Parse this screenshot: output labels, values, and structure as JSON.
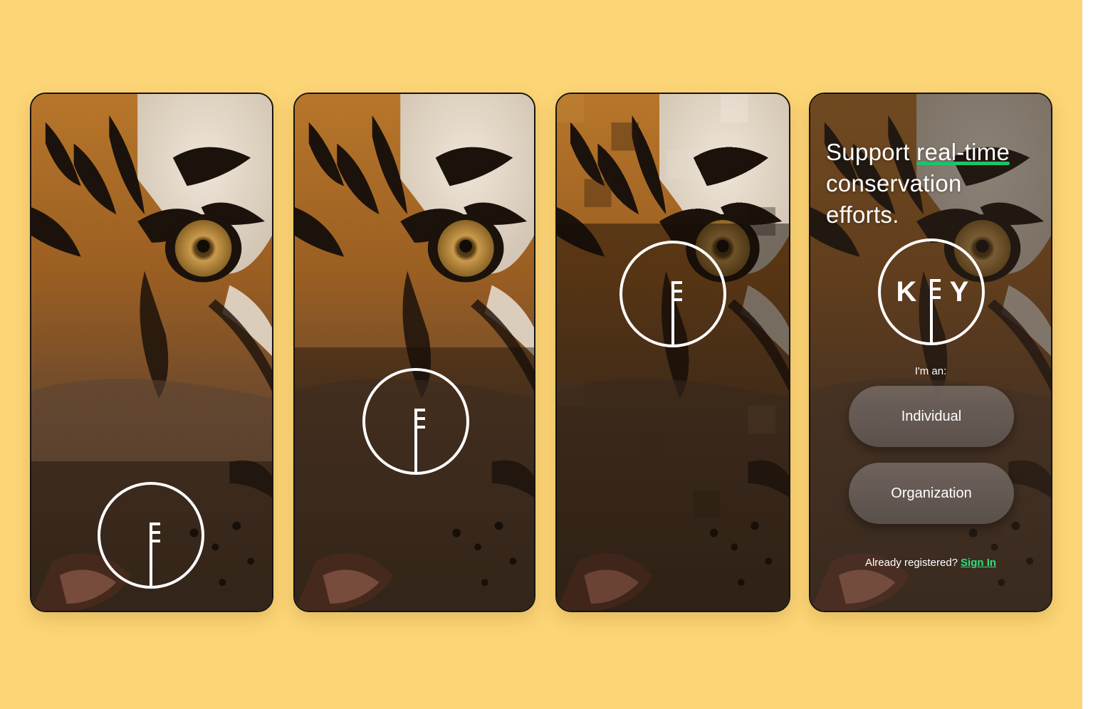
{
  "colors": {
    "background": "#fcd576",
    "accent": "#1ec46c",
    "link": "#2ee07e",
    "logo_stroke": "#ffffff"
  },
  "logo_icon": "key-circle-logo",
  "screens": [
    {
      "image_icon": "tiger-face-photo"
    },
    {
      "image_icon": "tiger-face-photo"
    },
    {
      "image_icon": "tiger-face-photo-pixelated"
    },
    {
      "image_icon": "tiger-face-photo",
      "headline_prefix": "Support ",
      "headline_highlight": "real-time",
      "headline_suffix": "conservation efforts.",
      "logo_letter_1": "K",
      "logo_letter_2": "Y",
      "prompt": "I'm an:",
      "individual_button": "Individual",
      "organization_button": "Organization",
      "already_registered": "Already registered?",
      "sign_in": "Sign In"
    }
  ]
}
